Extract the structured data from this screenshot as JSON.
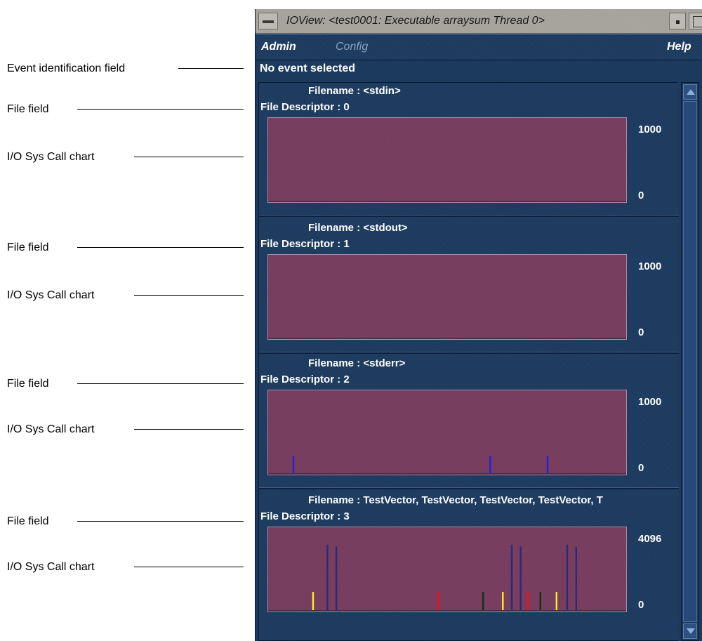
{
  "callouts": [
    {
      "label": "Event identification field"
    },
    {
      "label": "File field"
    },
    {
      "label": "I/O Sys Call chart"
    },
    {
      "label": "File field"
    },
    {
      "label": "I/O Sys Call chart"
    },
    {
      "label": "File field"
    },
    {
      "label": "I/O Sys Call chart"
    },
    {
      "label": "File field"
    },
    {
      "label": "I/O Sys Call chart"
    }
  ],
  "window": {
    "title": "IOView: <test0001: Executable arraysum Thread 0>",
    "menu": {
      "admin": "Admin",
      "config": "Config",
      "help": "Help"
    },
    "event_field": "No event selected"
  },
  "panels": [
    {
      "filename": "Filename : <stdin>",
      "descriptor": "File Descriptor : 0",
      "ymax": "1000",
      "ymin": "0"
    },
    {
      "filename": "Filename : <stdout>",
      "descriptor": "File Descriptor : 1",
      "ymax": "1000",
      "ymin": "0"
    },
    {
      "filename": "Filename : <stderr>",
      "descriptor": "File Descriptor : 2",
      "ymax": "1000",
      "ymin": "0"
    },
    {
      "filename": "Filename : TestVector, TestVector, TestVector, TestVector, T",
      "descriptor": "File Descriptor : 3",
      "ymax": "4096",
      "ymin": "0"
    }
  ],
  "colors": {
    "chart_bg": "#7a3f61",
    "window_bg": "#1c3a5e",
    "write": "#2222dd",
    "read": "#2a2a7a",
    "seek": "#ffee22",
    "open": "#ee1111",
    "close": "#113311"
  },
  "chart_data": [
    {
      "type": "bar",
      "ylim": [
        0,
        1000
      ],
      "x_range": [
        0,
        100
      ],
      "bars": []
    },
    {
      "type": "bar",
      "ylim": [
        0,
        1000
      ],
      "x_range": [
        0,
        100
      ],
      "bars": []
    },
    {
      "type": "bar",
      "ylim": [
        0,
        1000
      ],
      "x_range": [
        0,
        100
      ],
      "bars": [
        {
          "x": 7,
          "value": 230,
          "kind": "write"
        },
        {
          "x": 62,
          "value": 230,
          "kind": "write"
        },
        {
          "x": 78,
          "value": 230,
          "kind": "write"
        }
      ]
    },
    {
      "type": "bar",
      "ylim": [
        0,
        4096
      ],
      "x_range": [
        0,
        100
      ],
      "bars": [
        {
          "x": 12.5,
          "value": 1000,
          "kind": "seek"
        },
        {
          "x": 16.5,
          "value": 3600,
          "kind": "read"
        },
        {
          "x": 19,
          "value": 3500,
          "kind": "read"
        },
        {
          "x": 47.5,
          "value": 1000,
          "kind": "open"
        },
        {
          "x": 60,
          "value": 1000,
          "kind": "close"
        },
        {
          "x": 65.5,
          "value": 1000,
          "kind": "seek"
        },
        {
          "x": 68,
          "value": 3600,
          "kind": "read"
        },
        {
          "x": 70.5,
          "value": 3500,
          "kind": "read"
        },
        {
          "x": 72.5,
          "value": 1000,
          "kind": "open"
        },
        {
          "x": 76,
          "value": 1000,
          "kind": "close"
        },
        {
          "x": 80.5,
          "value": 1000,
          "kind": "seek"
        },
        {
          "x": 83.5,
          "value": 3600,
          "kind": "read"
        },
        {
          "x": 86,
          "value": 3500,
          "kind": "read"
        }
      ]
    }
  ]
}
